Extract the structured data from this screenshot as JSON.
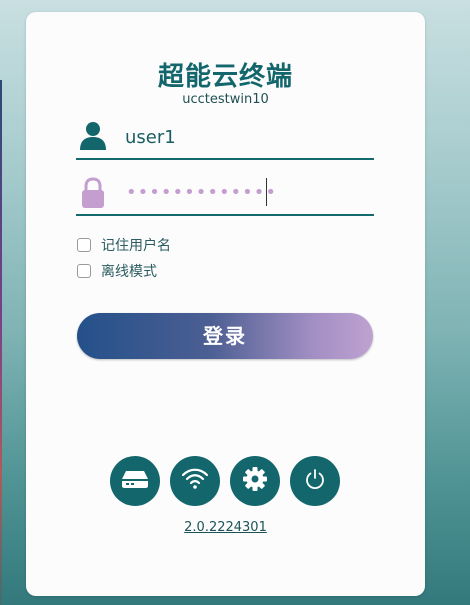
{
  "app": {
    "title": "超能云终端",
    "machine_name": "ucctestwin10"
  },
  "login_form": {
    "username_value": "user1",
    "password_masked": "•••••••••••••",
    "remember_username_label": "记住用户名",
    "remember_username_checked": false,
    "offline_mode_label": "离线模式",
    "offline_mode_checked": false,
    "login_button_label": "登录"
  },
  "toolbar": {
    "buttons": [
      {
        "icon": "drive-icon"
      },
      {
        "icon": "wifi-icon"
      },
      {
        "icon": "gear-icon"
      },
      {
        "icon": "power-icon"
      }
    ]
  },
  "footer": {
    "version": "2.0.2224301"
  },
  "colors": {
    "primary": "#13676c",
    "button_gradient_start": "#24508a",
    "button_gradient_end": "#bea2d1",
    "lock_icon": "#c49ecf",
    "card_background": "#fcfcfc"
  }
}
